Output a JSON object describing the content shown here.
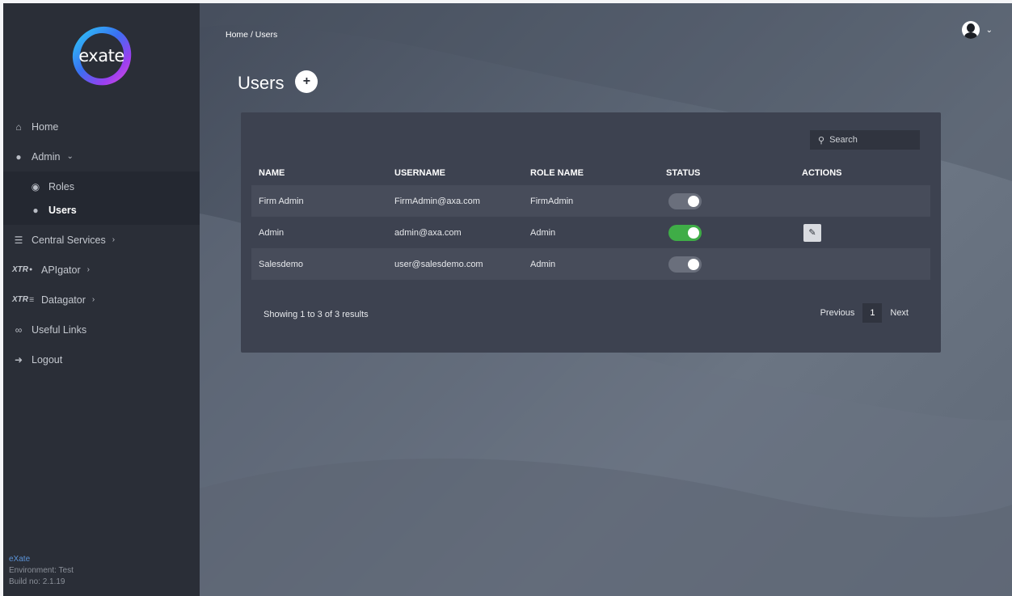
{
  "logo": {
    "text": "exate"
  },
  "sidebar": {
    "home": "Home",
    "admin": "Admin",
    "roles": "Roles",
    "users": "Users",
    "central_services": "Central Services",
    "apigator": "APIgator",
    "datagator": "Datagator",
    "useful_links": "Useful Links",
    "logout": "Logout",
    "brand_icon_text": "XTR"
  },
  "footer": {
    "brand": "eXate",
    "environment": "Environment: Test",
    "build": "Build no: 2.1.19"
  },
  "breadcrumb": {
    "home": "Home",
    "separator": "/",
    "current": "Users"
  },
  "page": {
    "title": "Users",
    "add_label": "+"
  },
  "search": {
    "placeholder": "Search"
  },
  "table": {
    "headers": [
      "NAME",
      "USERNAME",
      "ROLE NAME",
      "STATUS",
      "ACTIONS"
    ],
    "rows": [
      {
        "name": "Firm Admin",
        "username": "FirmAdmin@axa.com",
        "role": "FirmAdmin",
        "status": "off",
        "editable": false
      },
      {
        "name": "Admin",
        "username": "admin@axa.com",
        "role": "Admin",
        "status": "on",
        "editable": true
      },
      {
        "name": "Salesdemo",
        "username": "user@salesdemo.com",
        "role": "Admin",
        "status": "off",
        "editable": false
      }
    ]
  },
  "pagination": {
    "showing": "Showing 1 to 3 of 3 results",
    "previous": "Previous",
    "current": "1",
    "next": "Next"
  },
  "colors": {
    "sidebar_bg": "#2a2e37",
    "card_bg": "#3d4250",
    "toggle_on": "#3fad47",
    "toggle_off": "#6a6f7c",
    "footer_brand": "#5b93d8"
  }
}
